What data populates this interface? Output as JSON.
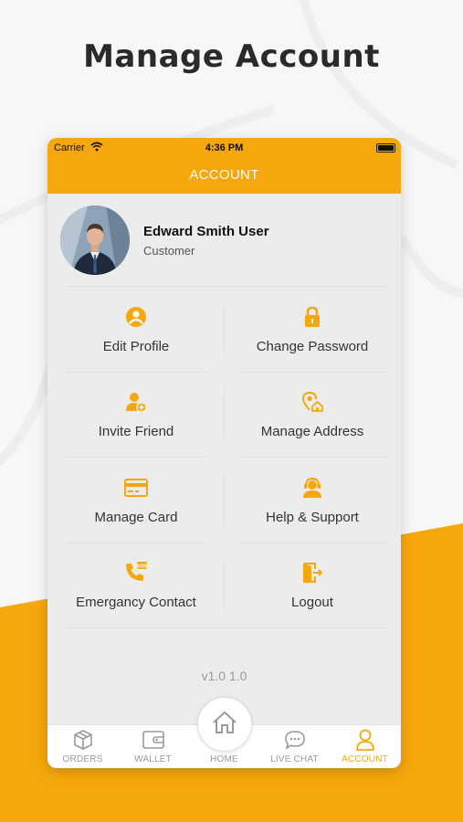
{
  "headline": "Manage Account",
  "colors": {
    "accent": "#f6a70b",
    "background": "#f7f7f7",
    "card": "#ececec"
  },
  "status_bar": {
    "carrier": "Carrier",
    "time": "4:36 PM"
  },
  "app_bar": {
    "title": "ACCOUNT"
  },
  "profile": {
    "name": "Edward Smith User",
    "role": "Customer"
  },
  "menu": [
    {
      "label": "Edit Profile",
      "icon": "user-circle-icon"
    },
    {
      "label": "Change Password",
      "icon": "lock-icon"
    },
    {
      "label": "Invite Friend",
      "icon": "user-add-icon"
    },
    {
      "label": "Manage Address",
      "icon": "location-home-icon"
    },
    {
      "label": "Manage Card",
      "icon": "credit-card-icon"
    },
    {
      "label": "Help & Support",
      "icon": "support-agent-icon"
    },
    {
      "label": "Emergancy Contact",
      "icon": "sos-phone-icon"
    },
    {
      "label": "Logout",
      "icon": "logout-door-icon"
    }
  ],
  "version": "v1.0 1.0",
  "tabs": [
    {
      "label": "ORDERS",
      "icon": "box-icon",
      "active": false
    },
    {
      "label": "WALLET",
      "icon": "wallet-icon",
      "active": false
    },
    {
      "label": "HOME",
      "icon": "home-icon",
      "active": false
    },
    {
      "label": "LIVE CHAT",
      "icon": "chat-bubble-icon",
      "active": false
    },
    {
      "label": "ACCOUNT",
      "icon": "person-icon",
      "active": true
    }
  ]
}
